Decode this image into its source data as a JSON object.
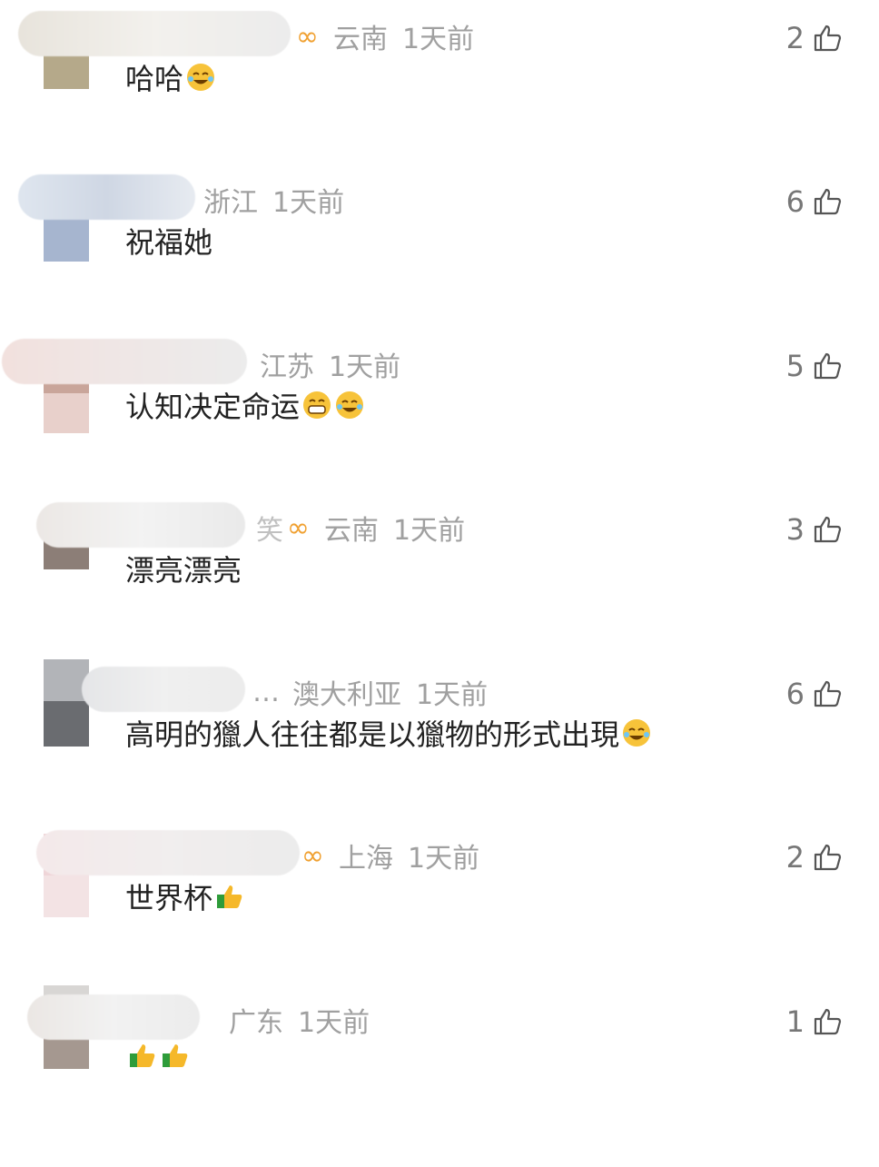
{
  "comments": [
    {
      "name_suffix": "",
      "location": "云南",
      "time": "1天前",
      "text": "哈哈",
      "likes": "2",
      "badge": true,
      "emojis": [
        "laugh-cry-emoji"
      ]
    },
    {
      "name_suffix": "",
      "location": "浙江",
      "time": "1天前",
      "text": "祝福她",
      "likes": "6",
      "badge": false,
      "emojis": []
    },
    {
      "name_suffix": "",
      "location": "江苏",
      "time": "1天前",
      "text": "认知决定命运",
      "likes": "5",
      "badge": false,
      "emojis": [
        "grin-emoji",
        "laugh-cry-emoji"
      ]
    },
    {
      "name_suffix": "笑",
      "location": "云南",
      "time": "1天前",
      "text": "漂亮漂亮",
      "likes": "3",
      "badge": true,
      "emojis": []
    },
    {
      "name_suffix": "…",
      "location": "澳大利亚",
      "time": "1天前",
      "text": "高明的獵人往往都是以獵物的形式出現",
      "likes": "6",
      "badge": false,
      "emojis": [
        "laugh-cry-emoji"
      ]
    },
    {
      "name_suffix": "",
      "location": "上海",
      "time": "1天前",
      "text": "世界杯",
      "likes": "2",
      "badge": true,
      "emojis": [
        "thumbs-up-emoji"
      ]
    },
    {
      "name_suffix": "",
      "location": "广东",
      "time": "1天前",
      "text": "",
      "likes": "1",
      "badge": false,
      "emojis": [
        "thumbs-up-emoji",
        "thumbs-up-emoji"
      ]
    }
  ],
  "badge_glyph": "∞",
  "colors": {
    "meta": "#a0a0a0",
    "text": "#222222",
    "badge": "#f0a030"
  }
}
